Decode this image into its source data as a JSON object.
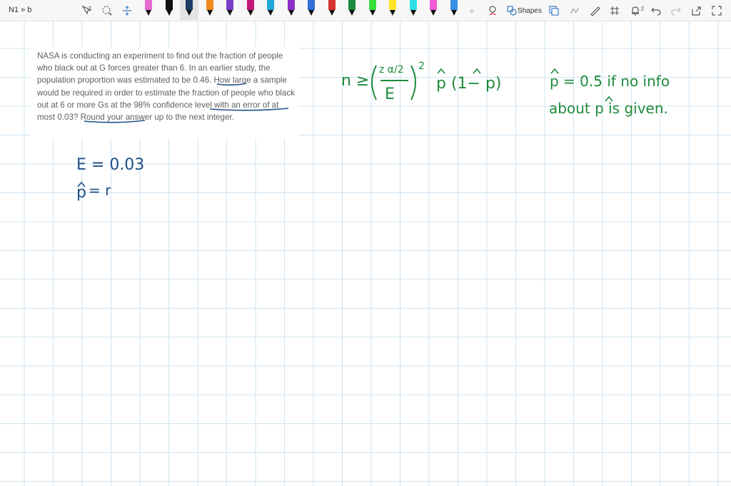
{
  "document": {
    "title": "N1 » b"
  },
  "toolbar": {
    "shapes_label": "Shapes",
    "notification_count": "2",
    "pens": [
      {
        "name": "pen-pink",
        "color": "#e56ad0"
      },
      {
        "name": "pen-black-1",
        "color": "#111111"
      },
      {
        "name": "pen-navy-selected",
        "color": "#1b3f66"
      },
      {
        "name": "pen-orange",
        "color": "#f08a1c"
      },
      {
        "name": "pen-purple",
        "color": "#7a3fc8"
      },
      {
        "name": "pen-magenta",
        "color": "#c2187a"
      },
      {
        "name": "pen-cyan",
        "color": "#22a6d6"
      },
      {
        "name": "pen-violet",
        "color": "#8b2fc9"
      },
      {
        "name": "pen-blue",
        "color": "#2f6fd6"
      },
      {
        "name": "pen-red",
        "color": "#d6332f"
      },
      {
        "name": "pen-green-dark",
        "color": "#1a8a3c"
      },
      {
        "name": "pen-highlighter-green",
        "color": "#39e03a"
      },
      {
        "name": "pen-highlighter-yellow",
        "color": "#ffe62a"
      },
      {
        "name": "pen-highlighter-cyan",
        "color": "#2ee0e6"
      },
      {
        "name": "pen-highlighter-pink",
        "color": "#f05bd6"
      },
      {
        "name": "pen-highlighter-blue",
        "color": "#3a8ee6"
      }
    ]
  },
  "question": {
    "text": "NASA is conducting an experiment to find out the fraction of people who black out at G forces greater than 6. In an earlier study, the population proportion was estimated to be 0.46. How large a sample would be required in order to estimate the fraction of people who black out at 6 or more Gs at the 98% confidence level with an error of at most 0.03? Round your answer up to the next integer."
  },
  "ink": {
    "colors": {
      "navy": "#1f4e86",
      "green": "#1e8a3c"
    },
    "e_line": "E = 0.03",
    "p_line_left": "p",
    "p_line_right": "= r",
    "formula_n": "n ≥",
    "formula_z": "z α/2",
    "formula_e": "E",
    "formula_exp": "2",
    "formula_tail": "p (1− p)",
    "note_line1": "p = 0.5  if no info",
    "note_line2": "about  p  is given."
  }
}
